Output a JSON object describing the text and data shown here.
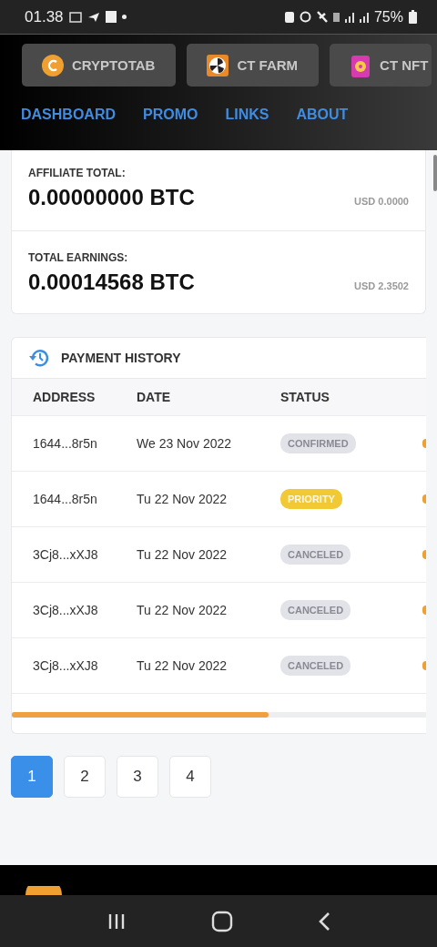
{
  "status_bar": {
    "time": "01.38",
    "battery": "75%"
  },
  "apps": [
    {
      "label": "CRYPTOTAB",
      "kind": "coin"
    },
    {
      "label": "CT FARM",
      "kind": "fan"
    },
    {
      "label": "CT NFT",
      "kind": "nft"
    }
  ],
  "nav": [
    {
      "label": "DASHBOARD"
    },
    {
      "label": "PROMO"
    },
    {
      "label": "LINKS"
    },
    {
      "label": "ABOUT"
    }
  ],
  "totals": [
    {
      "label": "AFFILIATE TOTAL:",
      "value": "0.00000000 BTC",
      "usd": "USD 0.0000"
    },
    {
      "label": "TOTAL EARNINGS:",
      "value": "0.00014568 BTC",
      "usd": "USD 2.3502"
    }
  ],
  "payment_history": {
    "title": "PAYMENT HISTORY",
    "columns": [
      "ADDRESS",
      "DATE",
      "STATUS"
    ],
    "rows": [
      {
        "address": "1644...8r5n",
        "date": "We 23 Nov 2022",
        "status": "CONFIRMED",
        "kind": "confirmed"
      },
      {
        "address": "1644...8r5n",
        "date": "Tu 22 Nov 2022",
        "status": "PRIORITY",
        "kind": "priority"
      },
      {
        "address": "3Cj8...xXJ8",
        "date": "Tu 22 Nov 2022",
        "status": "CANCELED",
        "kind": "canceled"
      },
      {
        "address": "3Cj8...xXJ8",
        "date": "Tu 22 Nov 2022",
        "status": "CANCELED",
        "kind": "canceled"
      },
      {
        "address": "3Cj8...xXJ8",
        "date": "Tu 22 Nov 2022",
        "status": "CANCELED",
        "kind": "canceled"
      }
    ]
  },
  "pagination": [
    {
      "label": "1",
      "selected": true
    },
    {
      "label": "2",
      "selected": false
    },
    {
      "label": "3",
      "selected": false
    },
    {
      "label": "4",
      "selected": false
    }
  ]
}
